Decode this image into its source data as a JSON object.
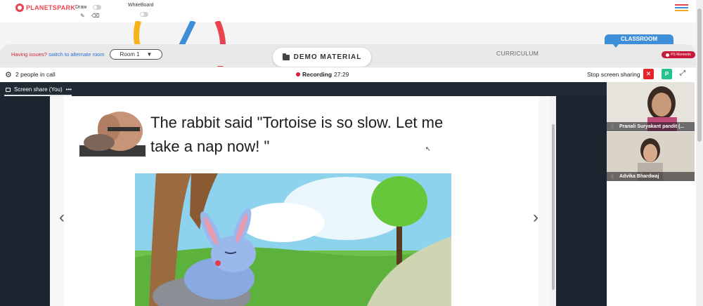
{
  "brand": {
    "logo_text": "PLANETSPARK",
    "color": "#e8434f"
  },
  "toolbar": {
    "draw_label": "Draw",
    "whiteboard_label": "WhiteBoard"
  },
  "classroom": {
    "issues_text": "Having issues?",
    "alternate_link": "switch to alternate room",
    "room_value": "Room 1",
    "demo_material": "DEMO MATERIAL",
    "curriculum": "CURRICULUM",
    "classroom_tab": "CLASSROOM",
    "ps_moments": "PS Moments"
  },
  "call": {
    "people": "2 people in call",
    "recording_label": "Recording",
    "recording_time": "27:29",
    "stop_sharing": "Stop screen sharing",
    "p_badge": "P"
  },
  "share": {
    "label": "Screen share (You)",
    "more": "•••"
  },
  "slide": {
    "line1": "The rabbit said \"Tortoise is so slow. Let me",
    "line2": "take a nap now! \""
  },
  "participants": [
    {
      "name": "Pranali Suryakant pandit (..."
    },
    {
      "name": "Advika Bhardwaj"
    }
  ],
  "colors": {
    "accent_blue": "#3d8fd9",
    "recording_red": "#d81b3c",
    "stop_red": "#e3242b",
    "p_green": "#23c48b",
    "stage_dark": "#1a2530"
  },
  "icons": [
    "planetspark-logo-icon",
    "pencil-icon",
    "eraser-icon",
    "hamburger-menu-icon",
    "folder-icon",
    "gear-icon",
    "close-icon",
    "fullscreen-icon",
    "screen-share-icon",
    "microphone-icon",
    "chevron-left-icon",
    "chevron-right-icon"
  ]
}
